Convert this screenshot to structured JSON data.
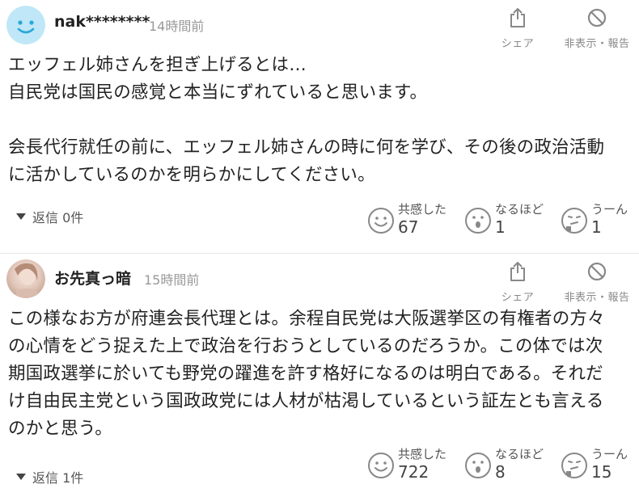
{
  "comments": [
    {
      "username": "nak********",
      "timestamp": "14時間前",
      "share_label": "シェア",
      "report_label": "非表示・報告",
      "body": "エッフェル姉さんを担ぎ上げるとは…\n自民党は国民の感覚と本当にずれていると思います。\n\n会長代行就任の前に、エッフェル姉さんの時に何を学び、その後の政治活動\nに活かしているのかを明らかにしてください。",
      "replies": "返信 0件",
      "reactions": [
        {
          "label": "共感した",
          "count": "67",
          "icon": "smile-face-icon"
        },
        {
          "label": "なるほど",
          "count": "1",
          "icon": "surprised-face-icon"
        },
        {
          "label": "うーん",
          "count": "1",
          "icon": "thinking-face-icon"
        }
      ]
    },
    {
      "username": "お先真っ暗",
      "timestamp": "15時間前",
      "share_label": "シェア",
      "report_label": "非表示・報告",
      "body": "この様なお方が府連会長代理とは。余程自民党は大阪選挙区の有権者の方々\nの心情をどう捉えた上で政治を行おうとしているのだろうか。この体では次\n期国政選挙に於いても野党の躍進を許す格好になるのは明白である。それだ\nけ自由民主党という国政政党には人材が枯渇しているという証左とも言える\nのかと思う。",
      "replies": "返信 1件",
      "reactions": [
        {
          "label": "共感した",
          "count": "722",
          "icon": "smile-face-icon"
        },
        {
          "label": "なるほど",
          "count": "8",
          "icon": "surprised-face-icon"
        },
        {
          "label": "うーん",
          "count": "15",
          "icon": "thinking-face-icon"
        }
      ]
    }
  ],
  "colors": {
    "avatar_default_bg": "#bfe7f7",
    "avatar_face": "#2aa8d8",
    "icon_gray": "#888888",
    "divider": "#e6e6e6"
  }
}
